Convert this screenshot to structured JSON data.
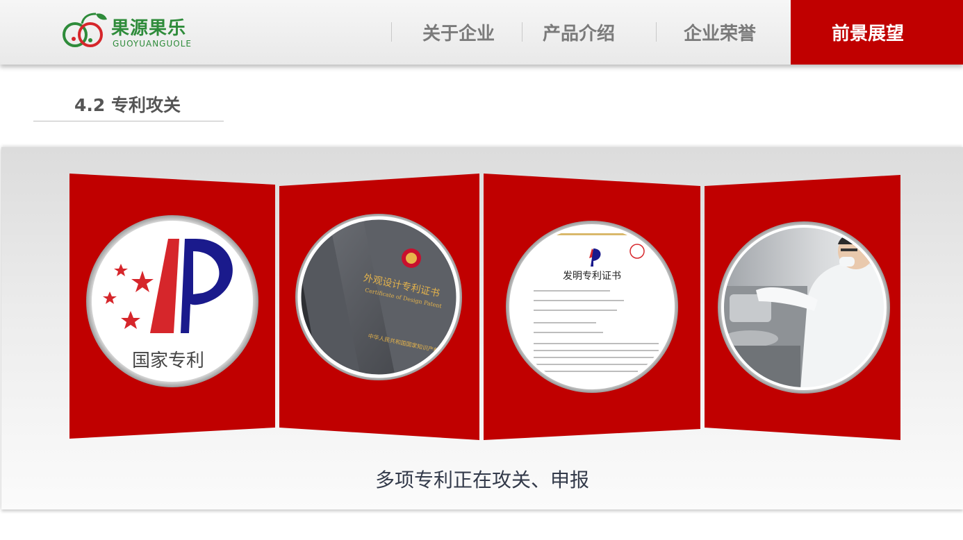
{
  "brand": {
    "name_cn": "果源果乐",
    "name_en": "GUOYUANGUOLE",
    "green": "#2e8b3a",
    "red": "#d6262b"
  },
  "nav": {
    "items": [
      "关于企业",
      "产品介绍",
      "企业荣誉"
    ],
    "active": "前景展望",
    "active_color": "#c00000"
  },
  "section": {
    "title": "4.2 专利攻关"
  },
  "cards": [
    {
      "icon": "national-patent-logo",
      "text": "国家专利"
    },
    {
      "icon": "design-patent-certificate-photo",
      "text_title": "外观设计专利证书",
      "text_sub": "Certificate of Design Patent",
      "text_footer": "中华人民共和国国家知识产权局"
    },
    {
      "icon": "invention-patent-certificate",
      "text_title": "发明专利证书"
    },
    {
      "icon": "lab-technician-photo"
    }
  ],
  "caption": "多项专利正在攻关、申报"
}
